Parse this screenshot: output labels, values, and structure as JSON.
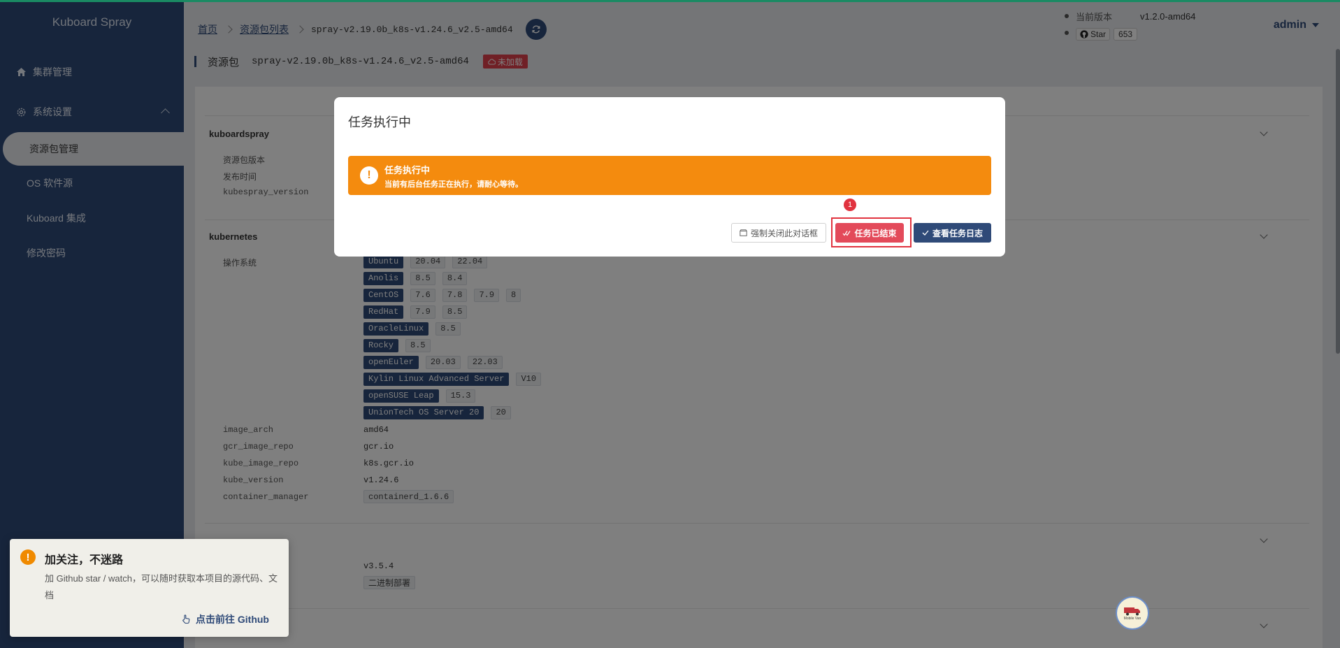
{
  "app": {
    "brand": "Kuboard Spray"
  },
  "sidebar": {
    "items": [
      {
        "label": "集群管理",
        "icon": "home-icon"
      },
      {
        "label": "系统设置",
        "icon": "gear-icon"
      }
    ],
    "sub_items": [
      {
        "label": "资源包管理",
        "active": true
      },
      {
        "label": "OS 软件源"
      },
      {
        "label": "Kuboard 集成"
      },
      {
        "label": "修改密码"
      }
    ]
  },
  "header": {
    "breadcrumb": [
      "首页",
      "资源包列表",
      "spray-v2.19.0b_k8s-v1.24.6_v2.5-amd64"
    ],
    "version_label": "当前版本",
    "version_value": "v1.2.0-amd64",
    "github_star_label": "Star",
    "github_star_count": "653",
    "user": "admin"
  },
  "page": {
    "title": "资源包",
    "package_name": "spray-v2.19.0b_k8s-v1.24.6_v2.5-amd64",
    "status_tag": "未加载"
  },
  "content": {
    "section_kuboardspray": {
      "title": "kuboardspray",
      "labels": [
        "资源包版本",
        "发布时间",
        "kubespray_version"
      ]
    },
    "section_kubernetes": {
      "title": "kubernetes",
      "os_label": "操作系统",
      "os_list": [
        {
          "name": "Ubuntu",
          "versions": [
            "20.04",
            "22.04"
          ]
        },
        {
          "name": "Anolis",
          "versions": [
            "8.5",
            "8.4"
          ]
        },
        {
          "name": "CentOS",
          "versions": [
            "7.6",
            "7.8",
            "7.9",
            "8"
          ]
        },
        {
          "name": "RedHat",
          "versions": [
            "7.9",
            "8.5"
          ]
        },
        {
          "name": "OracleLinux",
          "versions": [
            "8.5"
          ]
        },
        {
          "name": "Rocky",
          "versions": [
            "8.5"
          ]
        },
        {
          "name": "openEuler",
          "versions": [
            "20.03",
            "22.03"
          ]
        },
        {
          "name": "Kylin Linux Advanced Server",
          "versions": [
            "V10"
          ]
        },
        {
          "name": "openSUSE Leap",
          "versions": [
            "15.3"
          ]
        },
        {
          "name": "UnionTech OS Server 20",
          "versions": [
            "20"
          ]
        }
      ],
      "fields": [
        {
          "label": "image_arch",
          "value": "amd64"
        },
        {
          "label": "gcr_image_repo",
          "value": "gcr.io"
        },
        {
          "label": "kube_image_repo",
          "value": "k8s.gcr.io"
        },
        {
          "label": "kube_version",
          "value": "v1.24.6"
        },
        {
          "label": "container_manager",
          "value": "containerd_1.6.6"
        }
      ]
    },
    "section_etcd": {
      "version_value": "v3.5.4",
      "deploy_tag": "二进制部署"
    }
  },
  "notification": {
    "title": "加关注，不迷路",
    "body": "加 Github star / watch，可以随时获取本项目的源代码、文档",
    "link": "点击前往 Github"
  },
  "floating_badge": {
    "text": "Mobile Van"
  },
  "dialog": {
    "title": "任务执行中",
    "alert_title": "任务执行中",
    "alert_desc": "当前有后台任务正在执行，请耐心等待。",
    "btn_force_close": "强制关闭此对话框",
    "btn_task_done": "任务已结束",
    "btn_view_log": "查看任务日志",
    "step_number": "1"
  },
  "colors": {
    "sidebar": "#2f4a78",
    "accent": "#2f4a78",
    "warning": "#f48b0e",
    "danger": "#e34a5a"
  }
}
